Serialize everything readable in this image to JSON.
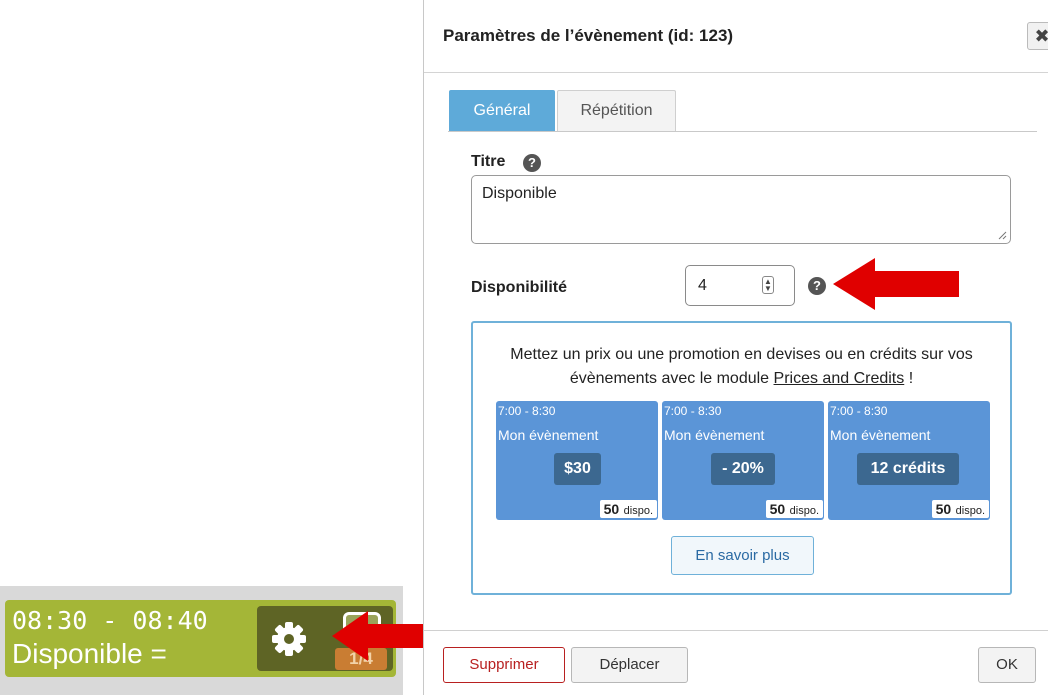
{
  "event_card": {
    "time": "08:30 - 08:40",
    "title": "Disponible =",
    "badge": "1/4"
  },
  "dialog": {
    "title": "Paramètres de l’évènement (id: 123)",
    "close_icon": "✖",
    "tabs": [
      {
        "label": "Général",
        "active": true
      },
      {
        "label": "Répétition",
        "active": false
      }
    ],
    "fields": {
      "title_label": "Titre",
      "title_value": "Disponible",
      "availability_label": "Disponibilité",
      "availability_value": "4",
      "help_glyph": "?"
    },
    "promo": {
      "text_before": "Mettez un prix ou une promotion en devises ou en crédits sur vos évènements avec le module",
      "link_text": "Prices and Credits",
      "text_after": "!",
      "cards": [
        {
          "time": "7:00 - 8:30",
          "name": "Mon évènement",
          "price": "$30",
          "dispo_count": "50",
          "dispo_label": "dispo."
        },
        {
          "time": "7:00 - 8:30",
          "name": "Mon évènement",
          "price": "- 20%",
          "dispo_count": "50",
          "dispo_label": "dispo."
        },
        {
          "time": "7:00 - 8:30",
          "name": "Mon évènement",
          "price": "12 crédits",
          "dispo_count": "50",
          "dispo_label": "dispo."
        }
      ],
      "learn_more": "En savoir plus"
    },
    "footer": {
      "delete": "Supprimer",
      "move": "Déplacer",
      "ok": "OK"
    }
  },
  "colors": {
    "event_green": "#a4b637",
    "tab_active": "#5eaad9",
    "promo_card": "#5b95d7",
    "arrow_red": "#e00000"
  },
  "icons": [
    "gear-icon",
    "close-icon",
    "help-icon",
    "arrow-annotation"
  ]
}
